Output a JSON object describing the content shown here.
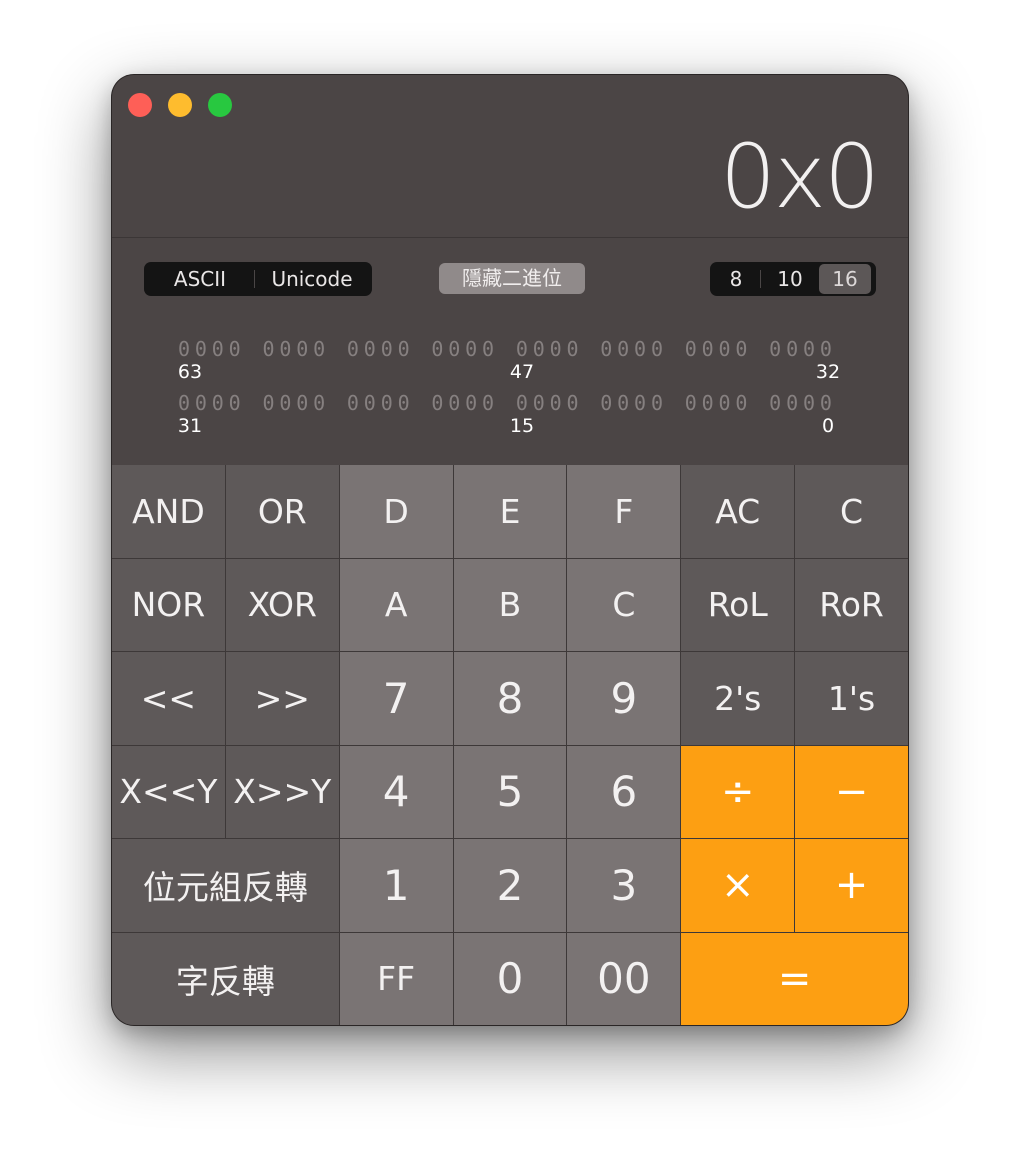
{
  "window": {
    "buttons": [
      "close",
      "minimize",
      "zoom"
    ]
  },
  "display": {
    "value": "0x0"
  },
  "encoding_selector": {
    "options": [
      "ASCII",
      "Unicode"
    ]
  },
  "hide_binary_button": {
    "label": "隱藏二進位"
  },
  "base_selector": {
    "options": [
      "8",
      "10",
      "16"
    ],
    "selected": "16"
  },
  "binary": {
    "row1": {
      "bits": "0000 0000 0000 0000 0000 0000 0000 0000",
      "labels": [
        "63",
        "47",
        "32"
      ]
    },
    "row2": {
      "bits": "0000 0000 0000 0000 0000 0000 0000 0000",
      "labels": [
        "31",
        "15",
        "0"
      ]
    }
  },
  "keys": {
    "and": "AND",
    "or": "OR",
    "d": "D",
    "e": "E",
    "f": "F",
    "ac": "AC",
    "c_clear": "C",
    "nor": "NOR",
    "xor": "XOR",
    "a": "A",
    "b": "B",
    "c_hex": "C",
    "rol": "RoL",
    "ror": "RoR",
    "shift_left": "<<",
    "shift_right": ">>",
    "seven": "7",
    "eight": "8",
    "nine": "9",
    "twos": "2's",
    "ones": "1's",
    "x_shl_y": "X<<Y",
    "x_shr_y": "X>>Y",
    "four": "4",
    "five": "5",
    "six": "6",
    "divide": "÷",
    "minus": "−",
    "byte_flip": "位元組反轉",
    "one": "1",
    "two": "2",
    "three": "3",
    "multiply": "×",
    "plus": "+",
    "word_flip": "字反轉",
    "ff": "FF",
    "zero": "0",
    "double_zero": "00",
    "equals": "="
  },
  "colors": {
    "operator_orange": "#fd9f12",
    "window_bg": "#4b4545",
    "digit_key": "#7a7474",
    "function_key": "#5e5959"
  }
}
